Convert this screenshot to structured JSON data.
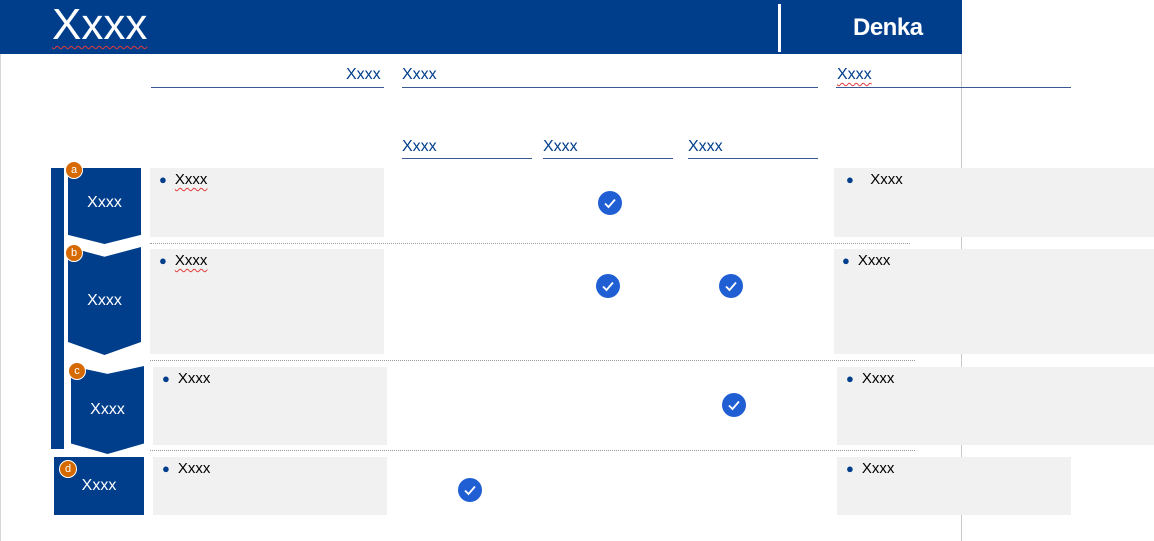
{
  "header": {
    "title": "Xxxx",
    "logo": "Denka"
  },
  "columns": {
    "col1": "Xxxx",
    "group": "Xxxx",
    "right": "Xxxx",
    "sub": [
      "Xxxx",
      "Xxxx",
      "Xxxx"
    ]
  },
  "rows": [
    {
      "badge": "a",
      "label": "Xxxx",
      "left_bullet": "Xxxx",
      "right_bullet": "Xxxx",
      "checks": [
        "sub2"
      ]
    },
    {
      "badge": "b",
      "label": "Xxxx",
      "left_bullet": "Xxxx",
      "right_bullet": "Xxxx",
      "checks": [
        "sub2",
        "sub3"
      ]
    },
    {
      "badge": "c",
      "label": "Xxxx",
      "left_bullet": "Xxxx",
      "right_bullet": "Xxxx",
      "checks": [
        "sub3"
      ]
    },
    {
      "badge": "d",
      "label": "Xxxx",
      "left_bullet": "Xxxx",
      "right_bullet": "Xxxx",
      "checks": [
        "sub1"
      ]
    }
  ],
  "colors": {
    "brand_blue": "#003e8c",
    "check_blue": "#1f5fd3",
    "badge_orange": "#d66a00",
    "box_grey": "#f1f1f1"
  },
  "icons": {
    "check": "check-circle-icon"
  }
}
